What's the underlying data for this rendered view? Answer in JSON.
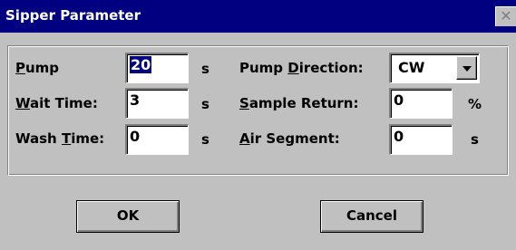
{
  "window": {
    "title": "Sipper Parameter",
    "close_glyph": "✕"
  },
  "left": {
    "pump": {
      "label_pre": "",
      "label_u": "P",
      "label_post": "ump",
      "value": "20",
      "unit": "s"
    },
    "wait_time": {
      "label_pre": "",
      "label_u": "W",
      "label_post": "ait Time:",
      "value": "3",
      "unit": "s"
    },
    "wash_time": {
      "label_pre": "Wash ",
      "label_u": "T",
      "label_post": "ime:",
      "value": "0",
      "unit": "s"
    }
  },
  "right": {
    "pump_direction": {
      "label_pre": "Pump ",
      "label_u": "D",
      "label_post": "irection:",
      "value": "CW"
    },
    "sample_return": {
      "label_pre": "",
      "label_u": "S",
      "label_post": "ample Return:",
      "value": "0",
      "unit": "%"
    },
    "air_segment": {
      "label_pre": "",
      "label_u": "A",
      "label_post": "ir Segment:",
      "value": "0",
      "unit": "s"
    }
  },
  "buttons": {
    "ok": "OK",
    "cancel": "Cancel"
  },
  "icons": {
    "combo_arrow": "chevron-down-icon",
    "close": "close-icon"
  }
}
